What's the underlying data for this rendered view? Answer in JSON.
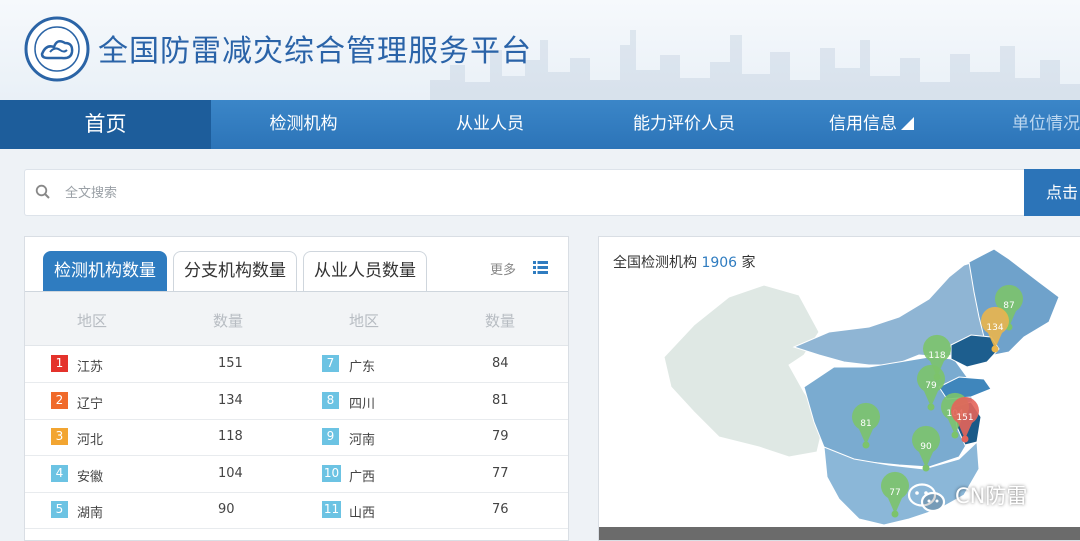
{
  "header": {
    "site_title": "全国防雷减灾综合管理服务平台"
  },
  "nav": {
    "items": [
      {
        "label": "首页",
        "active": true
      },
      {
        "label": "检测机构"
      },
      {
        "label": "从业人员"
      },
      {
        "label": "能力评价人员"
      },
      {
        "label": "信用信息"
      },
      {
        "label": "单位情况"
      }
    ]
  },
  "search": {
    "placeholder": "全文搜索",
    "button_label": "点击"
  },
  "stats_panel": {
    "tabs": [
      "检测机构数量",
      "分支机构数量",
      "从业人员数量"
    ],
    "more_label": "更多",
    "headers": [
      "地区",
      "数量",
      "地区",
      "数量"
    ],
    "rows": [
      {
        "rank_a": "1",
        "region_a": "江苏",
        "count_a": "151",
        "rank_b": "7",
        "region_b": "广东",
        "count_b": "84"
      },
      {
        "rank_a": "2",
        "region_a": "辽宁",
        "count_a": "134",
        "rank_b": "8",
        "region_b": "四川",
        "count_b": "81"
      },
      {
        "rank_a": "3",
        "region_a": "河北",
        "count_a": "118",
        "rank_b": "9",
        "region_b": "河南",
        "count_b": "79"
      },
      {
        "rank_a": "4",
        "region_a": "安徽",
        "count_a": "104",
        "rank_b": "10",
        "region_b": "广西",
        "count_b": "77"
      },
      {
        "rank_a": "5",
        "region_a": "湖南",
        "count_a": "90",
        "rank_b": "11",
        "region_b": "山西",
        "count_b": "76"
      }
    ],
    "colors": {
      "rank1": "#e4322b",
      "rank2": "#f06a2a",
      "rank3": "#f2a531",
      "rank_other": "#6cc3e3"
    }
  },
  "map_panel": {
    "title_prefix": "全国检测机构",
    "total": "1906",
    "title_suffix": "家",
    "markers": [
      {
        "value": "87",
        "color": "#7cc36b"
      },
      {
        "value": "134",
        "color": "#eab54c"
      },
      {
        "value": "118",
        "color": "#7cc36b"
      },
      {
        "value": "79",
        "color": "#7cc36b"
      },
      {
        "value": "104",
        "color": "#7cc36b"
      },
      {
        "value": "151",
        "color": "#e4645a"
      },
      {
        "value": "81",
        "color": "#7cc36b"
      },
      {
        "value": "90",
        "color": "#7cc36b"
      },
      {
        "value": "77",
        "color": "#7cc36b"
      }
    ]
  },
  "watermark": {
    "text": "CN防雷"
  }
}
